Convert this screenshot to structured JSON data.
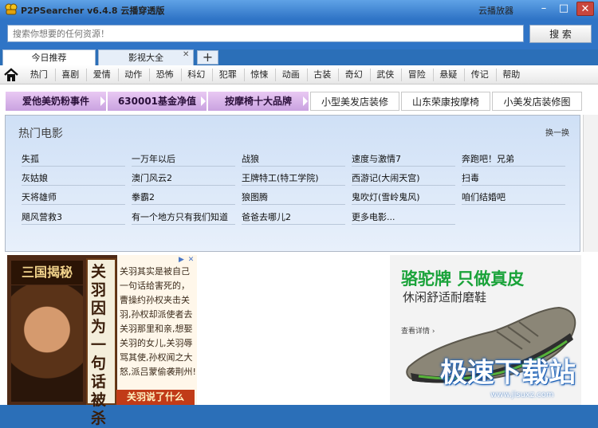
{
  "window": {
    "title": "P2PSearcher v6.4.8 云播穿透版",
    "cloud_player": "云播放器",
    "minimize": "–",
    "restore": "□",
    "close": "✕"
  },
  "search": {
    "placeholder": "搜索你想要的任何资源！",
    "button_label": "搜 索"
  },
  "tabs": [
    {
      "label": "今日推荐"
    },
    {
      "label": "影视大全"
    }
  ],
  "tab_close": "✕",
  "tab_add": "+",
  "nav": [
    "热门",
    "喜剧",
    "爱情",
    "动作",
    "恐怖",
    "科幻",
    "犯罪",
    "惊悚",
    "动画",
    "古装",
    "奇幻",
    "武侠",
    "冒险",
    "悬疑",
    "传记",
    "帮助"
  ],
  "banners": [
    "爱他美奶粉事件",
    "630001基金净值",
    "按摩椅十大品牌",
    "小型美发店装修",
    "山东荣康按摩椅",
    "小美发店装修图"
  ],
  "panel": {
    "title": "热门电影",
    "switch": "换一换",
    "movies": [
      [
        "失孤",
        "一万年以后",
        "战狼",
        "速度与激情7",
        "奔跑吧！兄弟"
      ],
      [
        "灰姑娘",
        "澳门风云2",
        "王牌特工(特工学院)",
        "西游记(大闹天宫)",
        "扫毒"
      ],
      [
        "天将雄师",
        "拳霸2",
        "狼图腾",
        "鬼吹灯(雪岭鬼风)",
        "咱们结婚吧"
      ],
      [
        "飓风营救3",
        "有一个地方只有我们知道",
        "爸爸去哪儿2",
        "更多电影..."
      ]
    ]
  },
  "ad_left": {
    "title": "三国揭秘",
    "vertical": "关羽因为一句话被杀",
    "text": "关羽其实是被自己一句话给害死的，曹操约孙权夹击关羽,孙权却派使者去关羽那里和亲,想娶关羽的女儿,关羽辱骂其使,孙权闻之大怒,派吕蒙偷袭荆州!",
    "banner": "关羽说了什么"
  },
  "ad_right": {
    "title": "骆驼牌 只做真皮",
    "sub": "休闲舒适耐磨鞋",
    "more": "查看详情 ›"
  },
  "watermark": {
    "text": "极速下载站",
    "url": "www.jisuxz.com"
  },
  "colors": {
    "titlebar": "#2f74c6",
    "banner_hot": "#d6b3ea",
    "ad_green": "#1aa33a",
    "close": "#c9463d"
  }
}
